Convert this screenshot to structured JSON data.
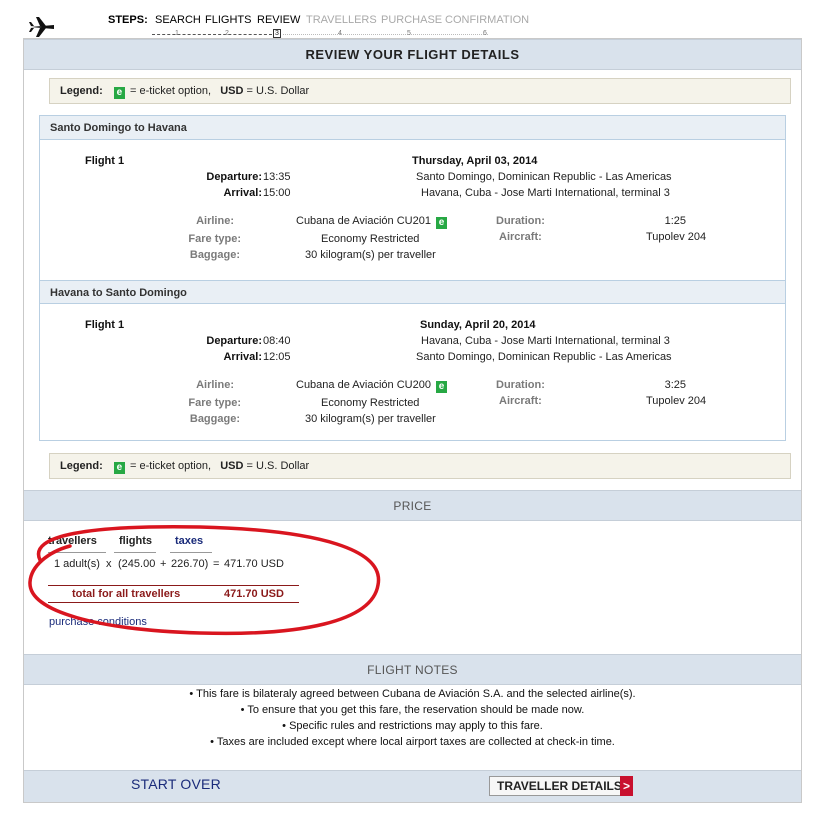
{
  "steps": {
    "label": "STEPS:",
    "items": [
      {
        "label": "SEARCH",
        "num": "1"
      },
      {
        "label": "FLIGHTS",
        "num": "2"
      },
      {
        "label": "REVIEW",
        "num": "3"
      },
      {
        "label": "TRAVELLERS",
        "num": "4"
      },
      {
        "label": "PURCHASE",
        "num": "5"
      },
      {
        "label": "CONFIRMATION",
        "num": "6"
      }
    ]
  },
  "page_title": "REVIEW YOUR FLIGHT DETAILS",
  "legend": {
    "label": "Legend:",
    "e_icon": "e",
    "e_text": "= e-ticket option,",
    "usd_label": "USD",
    "usd_text": "= U.S. Dollar"
  },
  "labels": {
    "departure": "Departure:",
    "arrival": "Arrival:",
    "airline": "Airline:",
    "fare_type": "Fare type:",
    "baggage": "Baggage:",
    "duration": "Duration:",
    "aircraft": "Aircraft:"
  },
  "segments": [
    {
      "route": "Santo Domingo to Havana",
      "flight_label": "Flight 1",
      "date": "Thursday, April 03, 2014",
      "dep_time": "13:35",
      "dep_place": "Santo Domingo, Dominican Republic - Las Americas",
      "arr_time": "15:00",
      "arr_place": "Havana, Cuba - Jose Marti International, terminal 3",
      "airline": "Cubana de Aviación CU201",
      "fare_type": "Economy Restricted",
      "baggage": "30 kilogram(s) per traveller",
      "duration": "1:25",
      "aircraft": "Tupolev 204"
    },
    {
      "route": "Havana to Santo Domingo",
      "flight_label": "Flight 1",
      "date": "Sunday, April 20, 2014",
      "dep_time": "08:40",
      "dep_place": "Havana, Cuba - Jose Marti International, terminal 3",
      "arr_time": "12:05",
      "arr_place": "Santo Domingo, Dominican Republic - Las Americas",
      "airline": "Cubana de Aviación CU200",
      "fare_type": "Economy Restricted",
      "baggage": "30 kilogram(s) per traveller",
      "duration": "3:25",
      "aircraft": "Tupolev 204"
    }
  ],
  "price": {
    "section_title": "PRICE",
    "col_travellers": "travellers",
    "col_flights": "flights",
    "col_taxes": "taxes",
    "qty": "1 adult(s)",
    "times": "x",
    "flights_amount": "(245.00",
    "plus": "+",
    "taxes_amount": "226.70)",
    "equals": "=",
    "line_total": "471.70 USD",
    "total_label": "total for all travellers",
    "total_value": "471.70 USD",
    "purchase_conditions": "purchase conditions"
  },
  "notes": {
    "section_title": "FLIGHT NOTES",
    "items": [
      "• This fare is bilateraly agreed between Cubana de Aviación S.A. and the selected airline(s).",
      "• To ensure that you get this fare, the reservation should be made now.",
      "• Specific rules and restrictions may apply to this fare.",
      "• Taxes are included except where local airport taxes are collected at check-in time."
    ]
  },
  "footer": {
    "start_over": "START OVER",
    "next_button": "TRAVELLER DETAILS",
    "next_arrow": ">"
  },
  "colors": {
    "band": "#d9e2ec",
    "eticket": "#27a844",
    "total_red": "#8b1a1a",
    "link_blue": "#1a2b7a",
    "annotation_red": "#d9151f"
  }
}
